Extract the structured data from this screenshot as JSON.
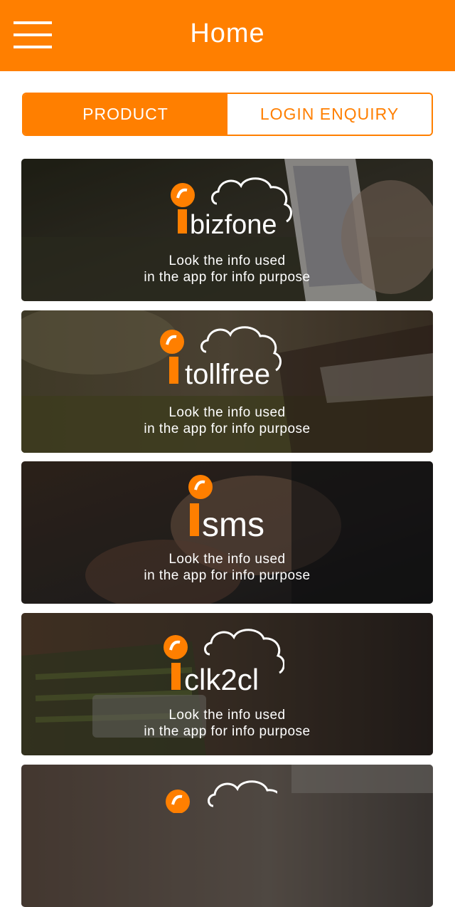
{
  "header": {
    "title": "Home",
    "menu_icon": "hamburger-menu-icon"
  },
  "tabs": [
    {
      "label": "PRODUCT",
      "active": true
    },
    {
      "label": "LOGIN ENQUIRY",
      "active": false
    }
  ],
  "colors": {
    "brand": "#ff7f00",
    "background": "#ffffff",
    "text_on_brand": "#ffffff"
  },
  "products": [
    {
      "name": "bizfone",
      "line1": "Look the info used",
      "line2": "in the app for info purpose",
      "icon": "phone-cloud-logo-icon"
    },
    {
      "name": "tollfree",
      "line1": "Look the info used",
      "line2": "in the app for info purpose",
      "icon": "phone-cloud-logo-icon"
    },
    {
      "name": "sms",
      "line1": "Look the info used",
      "line2": "in the app for info purpose",
      "icon": "phone-cloud-logo-icon"
    },
    {
      "name": "clk2cl",
      "line1": "Look the info used",
      "line2": "in the app for info purpose",
      "icon": "phone-cloud-logo-icon"
    },
    {
      "name": "",
      "line1": "",
      "line2": "",
      "icon": "phone-cloud-logo-icon"
    }
  ]
}
